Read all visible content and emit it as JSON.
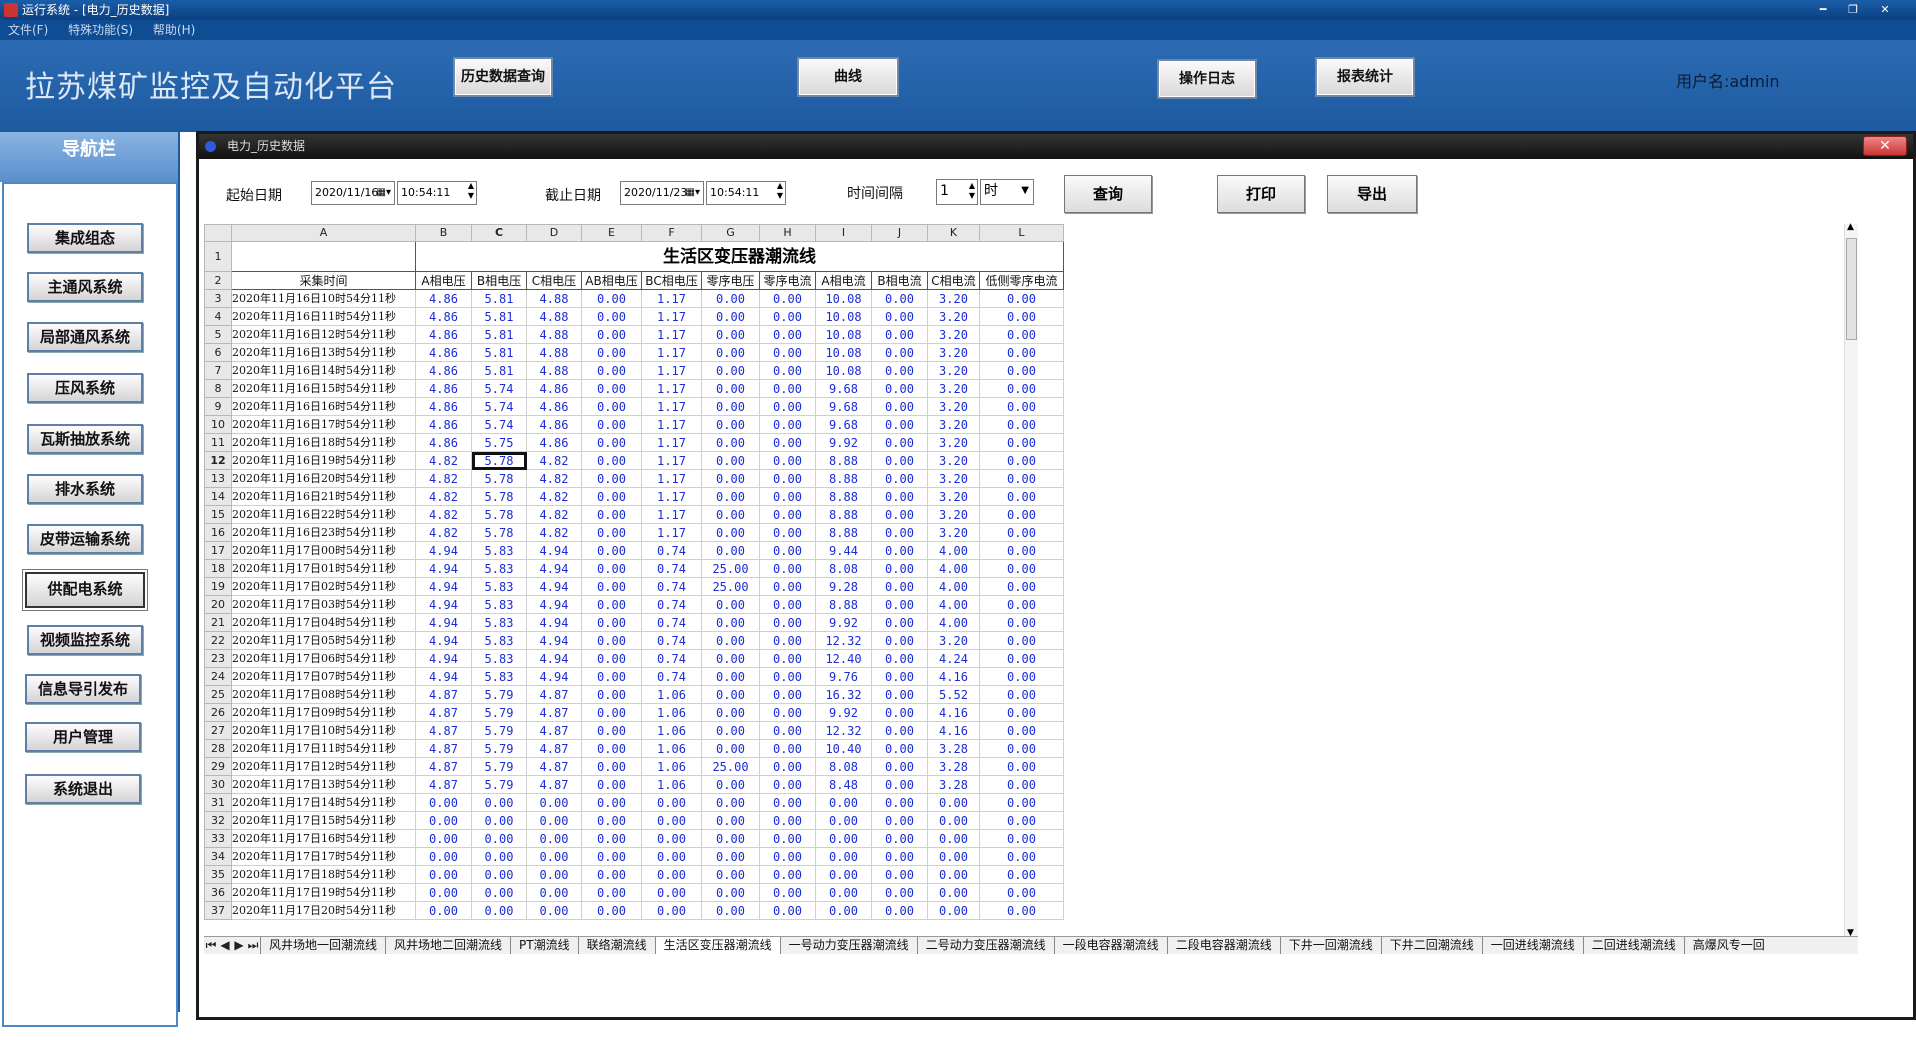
{
  "window": {
    "title": "运行系统 - [电力_历史数据]",
    "min": "━",
    "restore": "❐",
    "close": "✕"
  },
  "menu": [
    "文件(F)",
    "特殊功能(S)",
    "帮助(H)"
  ],
  "header": {
    "app_title": "拉苏煤矿监控及自动化平台",
    "buttons": [
      "历史数据查询",
      "曲线",
      "操作日志",
      "报表统计"
    ],
    "username": "用户名:admin"
  },
  "nav": {
    "title": "导航栏",
    "items": [
      "集成组态",
      "主通风系统",
      "局部通风系统",
      "压风系统",
      "瓦斯抽放系统",
      "排水系统",
      "皮带运输系统",
      "供配电系统",
      "视频监控系统",
      "信息导引发布",
      "用户管理",
      "系统退出"
    ],
    "active": "供配电系统"
  },
  "subwindow": {
    "title": "电力_历史数据",
    "close": "✕"
  },
  "toolbar": {
    "start_label": "起始日期",
    "start_date": "2020/11/16",
    "start_time": "10:54:11",
    "end_label": "截止日期",
    "end_date": "2020/11/23",
    "end_time": "10:54:11",
    "interval_label": "时间间隔",
    "interval_value": "1",
    "interval_unit": "时",
    "query": "查询",
    "print": "打印",
    "export": "导出"
  },
  "sheet": {
    "col_letters": [
      "A",
      "B",
      "C",
      "D",
      "E",
      "F",
      "G",
      "H",
      "I",
      "J",
      "K",
      "L"
    ],
    "title": "生活区变压器潮流线",
    "headers": [
      "采集时间",
      "A相电压",
      "B相电压",
      "C相电压",
      "AB相电压",
      "BC相电压",
      "零序电压",
      "零序电流",
      "A相电流",
      "B相电流",
      "C相电流",
      "低侧零序电流"
    ],
    "selected": {
      "row": 12,
      "col": "C"
    },
    "rows": [
      [
        "2020年11月16日10时54分11秒",
        "4.86",
        "5.81",
        "4.88",
        "0.00",
        "1.17",
        "0.00",
        "0.00",
        "10.08",
        "0.00",
        "3.20",
        "0.00"
      ],
      [
        "2020年11月16日11时54分11秒",
        "4.86",
        "5.81",
        "4.88",
        "0.00",
        "1.17",
        "0.00",
        "0.00",
        "10.08",
        "0.00",
        "3.20",
        "0.00"
      ],
      [
        "2020年11月16日12时54分11秒",
        "4.86",
        "5.81",
        "4.88",
        "0.00",
        "1.17",
        "0.00",
        "0.00",
        "10.08",
        "0.00",
        "3.20",
        "0.00"
      ],
      [
        "2020年11月16日13时54分11秒",
        "4.86",
        "5.81",
        "4.88",
        "0.00",
        "1.17",
        "0.00",
        "0.00",
        "10.08",
        "0.00",
        "3.20",
        "0.00"
      ],
      [
        "2020年11月16日14时54分11秒",
        "4.86",
        "5.81",
        "4.88",
        "0.00",
        "1.17",
        "0.00",
        "0.00",
        "10.08",
        "0.00",
        "3.20",
        "0.00"
      ],
      [
        "2020年11月16日15时54分11秒",
        "4.86",
        "5.74",
        "4.86",
        "0.00",
        "1.17",
        "0.00",
        "0.00",
        "9.68",
        "0.00",
        "3.20",
        "0.00"
      ],
      [
        "2020年11月16日16时54分11秒",
        "4.86",
        "5.74",
        "4.86",
        "0.00",
        "1.17",
        "0.00",
        "0.00",
        "9.68",
        "0.00",
        "3.20",
        "0.00"
      ],
      [
        "2020年11月16日17时54分11秒",
        "4.86",
        "5.74",
        "4.86",
        "0.00",
        "1.17",
        "0.00",
        "0.00",
        "9.68",
        "0.00",
        "3.20",
        "0.00"
      ],
      [
        "2020年11月16日18时54分11秒",
        "4.86",
        "5.75",
        "4.86",
        "0.00",
        "1.17",
        "0.00",
        "0.00",
        "9.92",
        "0.00",
        "3.20",
        "0.00"
      ],
      [
        "2020年11月16日19时54分11秒",
        "4.82",
        "5.78",
        "4.82",
        "0.00",
        "1.17",
        "0.00",
        "0.00",
        "8.88",
        "0.00",
        "3.20",
        "0.00"
      ],
      [
        "2020年11月16日20时54分11秒",
        "4.82",
        "5.78",
        "4.82",
        "0.00",
        "1.17",
        "0.00",
        "0.00",
        "8.88",
        "0.00",
        "3.20",
        "0.00"
      ],
      [
        "2020年11月16日21时54分11秒",
        "4.82",
        "5.78",
        "4.82",
        "0.00",
        "1.17",
        "0.00",
        "0.00",
        "8.88",
        "0.00",
        "3.20",
        "0.00"
      ],
      [
        "2020年11月16日22时54分11秒",
        "4.82",
        "5.78",
        "4.82",
        "0.00",
        "1.17",
        "0.00",
        "0.00",
        "8.88",
        "0.00",
        "3.20",
        "0.00"
      ],
      [
        "2020年11月16日23时54分11秒",
        "4.82",
        "5.78",
        "4.82",
        "0.00",
        "1.17",
        "0.00",
        "0.00",
        "8.88",
        "0.00",
        "3.20",
        "0.00"
      ],
      [
        "2020年11月17日00时54分11秒",
        "4.94",
        "5.83",
        "4.94",
        "0.00",
        "0.74",
        "0.00",
        "0.00",
        "9.44",
        "0.00",
        "4.00",
        "0.00"
      ],
      [
        "2020年11月17日01时54分11秒",
        "4.94",
        "5.83",
        "4.94",
        "0.00",
        "0.74",
        "25.00",
        "0.00",
        "8.08",
        "0.00",
        "4.00",
        "0.00"
      ],
      [
        "2020年11月17日02时54分11秒",
        "4.94",
        "5.83",
        "4.94",
        "0.00",
        "0.74",
        "25.00",
        "0.00",
        "9.28",
        "0.00",
        "4.00",
        "0.00"
      ],
      [
        "2020年11月17日03时54分11秒",
        "4.94",
        "5.83",
        "4.94",
        "0.00",
        "0.74",
        "0.00",
        "0.00",
        "8.88",
        "0.00",
        "4.00",
        "0.00"
      ],
      [
        "2020年11月17日04时54分11秒",
        "4.94",
        "5.83",
        "4.94",
        "0.00",
        "0.74",
        "0.00",
        "0.00",
        "9.92",
        "0.00",
        "4.00",
        "0.00"
      ],
      [
        "2020年11月17日05时54分11秒",
        "4.94",
        "5.83",
        "4.94",
        "0.00",
        "0.74",
        "0.00",
        "0.00",
        "12.32",
        "0.00",
        "3.20",
        "0.00"
      ],
      [
        "2020年11月17日06时54分11秒",
        "4.94",
        "5.83",
        "4.94",
        "0.00",
        "0.74",
        "0.00",
        "0.00",
        "12.40",
        "0.00",
        "4.24",
        "0.00"
      ],
      [
        "2020年11月17日07时54分11秒",
        "4.94",
        "5.83",
        "4.94",
        "0.00",
        "0.74",
        "0.00",
        "0.00",
        "9.76",
        "0.00",
        "4.16",
        "0.00"
      ],
      [
        "2020年11月17日08时54分11秒",
        "4.87",
        "5.79",
        "4.87",
        "0.00",
        "1.06",
        "0.00",
        "0.00",
        "16.32",
        "0.00",
        "5.52",
        "0.00"
      ],
      [
        "2020年11月17日09时54分11秒",
        "4.87",
        "5.79",
        "4.87",
        "0.00",
        "1.06",
        "0.00",
        "0.00",
        "9.92",
        "0.00",
        "4.16",
        "0.00"
      ],
      [
        "2020年11月17日10时54分11秒",
        "4.87",
        "5.79",
        "4.87",
        "0.00",
        "1.06",
        "0.00",
        "0.00",
        "12.32",
        "0.00",
        "4.16",
        "0.00"
      ],
      [
        "2020年11月17日11时54分11秒",
        "4.87",
        "5.79",
        "4.87",
        "0.00",
        "1.06",
        "0.00",
        "0.00",
        "10.40",
        "0.00",
        "3.28",
        "0.00"
      ],
      [
        "2020年11月17日12时54分11秒",
        "4.87",
        "5.79",
        "4.87",
        "0.00",
        "1.06",
        "25.00",
        "0.00",
        "8.08",
        "0.00",
        "3.28",
        "0.00"
      ],
      [
        "2020年11月17日13时54分11秒",
        "4.87",
        "5.79",
        "4.87",
        "0.00",
        "1.06",
        "0.00",
        "0.00",
        "8.48",
        "0.00",
        "3.28",
        "0.00"
      ],
      [
        "2020年11月17日14时54分11秒",
        "0.00",
        "0.00",
        "0.00",
        "0.00",
        "0.00",
        "0.00",
        "0.00",
        "0.00",
        "0.00",
        "0.00",
        "0.00"
      ],
      [
        "2020年11月17日15时54分11秒",
        "0.00",
        "0.00",
        "0.00",
        "0.00",
        "0.00",
        "0.00",
        "0.00",
        "0.00",
        "0.00",
        "0.00",
        "0.00"
      ],
      [
        "2020年11月17日16时54分11秒",
        "0.00",
        "0.00",
        "0.00",
        "0.00",
        "0.00",
        "0.00",
        "0.00",
        "0.00",
        "0.00",
        "0.00",
        "0.00"
      ],
      [
        "2020年11月17日17时54分11秒",
        "0.00",
        "0.00",
        "0.00",
        "0.00",
        "0.00",
        "0.00",
        "0.00",
        "0.00",
        "0.00",
        "0.00",
        "0.00"
      ],
      [
        "2020年11月17日18时54分11秒",
        "0.00",
        "0.00",
        "0.00",
        "0.00",
        "0.00",
        "0.00",
        "0.00",
        "0.00",
        "0.00",
        "0.00",
        "0.00"
      ],
      [
        "2020年11月17日19时54分11秒",
        "0.00",
        "0.00",
        "0.00",
        "0.00",
        "0.00",
        "0.00",
        "0.00",
        "0.00",
        "0.00",
        "0.00",
        "0.00"
      ],
      [
        "2020年11月17日20时54分11秒",
        "0.00",
        "0.00",
        "0.00",
        "0.00",
        "0.00",
        "0.00",
        "0.00",
        "0.00",
        "0.00",
        "0.00",
        "0.00"
      ]
    ]
  },
  "sheet_tabs": [
    "风井场地一回潮流线",
    "风井场地二回潮流线",
    "PT潮流线",
    "联络潮流线",
    "生活区变压器潮流线",
    "一号动力变压器潮流线",
    "二号动力变压器潮流线",
    "一段电容器潮流线",
    "二段电容器潮流线",
    "下井一回潮流线",
    "下井二回潮流线",
    "一回进线潮流线",
    "二回进线潮流线",
    "高爆风专一回"
  ],
  "sheet_nav": [
    "⏮",
    "◀",
    "▶",
    "⏭"
  ],
  "active_tab": "生活区变压器潮流线"
}
